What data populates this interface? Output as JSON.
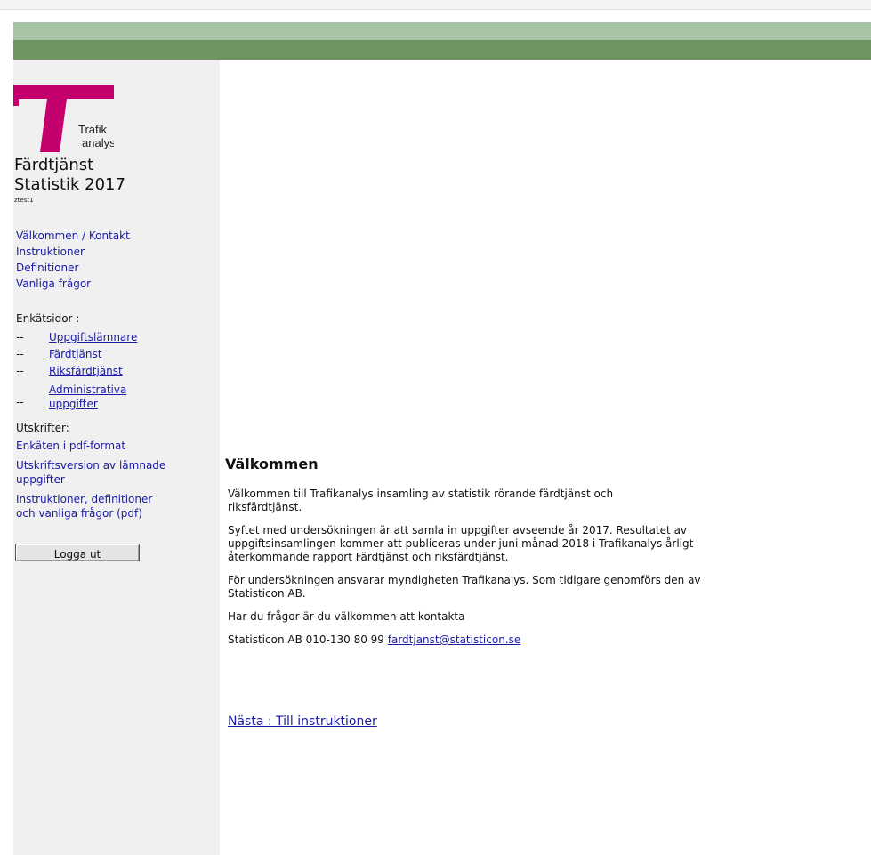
{
  "header": {
    "band_light": "#a9c3a6",
    "band_dark": "#6f9361"
  },
  "logo": {
    "text_line1": "Trafik",
    "text_line2": "analys",
    "color": "#c4006e"
  },
  "sidebar": {
    "title_line1": "Färdtjänst",
    "title_line2": "Statistik 2017",
    "user_id": "ztest1",
    "nav": [
      {
        "label": "Välkommen / Kontakt"
      },
      {
        "label": "Instruktioner"
      },
      {
        "label": "Definitioner"
      },
      {
        "label": "Vanliga frågor"
      }
    ],
    "survey_heading": "Enkätsidor :",
    "survey_pages": [
      {
        "dash": "--",
        "label": "Uppgiftslämnare"
      },
      {
        "dash": "--",
        "label": "Färdtjänst"
      },
      {
        "dash": "--",
        "label": "Riksfärdtjänst"
      },
      {
        "dash": "--",
        "label_line1": "Administrativa",
        "label_line2": "uppgifter"
      }
    ],
    "prints_heading": "Utskrifter:",
    "prints": [
      {
        "label": "Enkäten i pdf-format"
      },
      {
        "label": "Utskriftsversion av lämnade uppgifter"
      },
      {
        "label": "Instruktioner, definitioner och vanliga frågor (pdf)"
      }
    ],
    "logout_label": "Logga ut"
  },
  "main": {
    "heading": "Välkommen",
    "p1": "Välkommen till Trafikanalys insamling av statistik rörande färdtjänst och riksfärdtjänst.",
    "p2": "Syftet med undersökningen är att samla in uppgifter avseende år 2017. Resultatet av uppgiftsinsamlingen kommer att publiceras under juni månad 2018 i Trafikanalys årligt återkommande rapport Färdtjänst och riksfärdtjänst.",
    "p3": "För undersökningen ansvarar myndigheten Trafikanalys. Som tidigare genomförs den av Statisticon AB.",
    "p4": "Har du frågor är du välkommen att kontakta",
    "contact_text": "Statisticon AB 010-130 80 99 ",
    "contact_email": "fardtjanst@statisticon.se",
    "next_link": "Nästa : Till instruktioner"
  }
}
